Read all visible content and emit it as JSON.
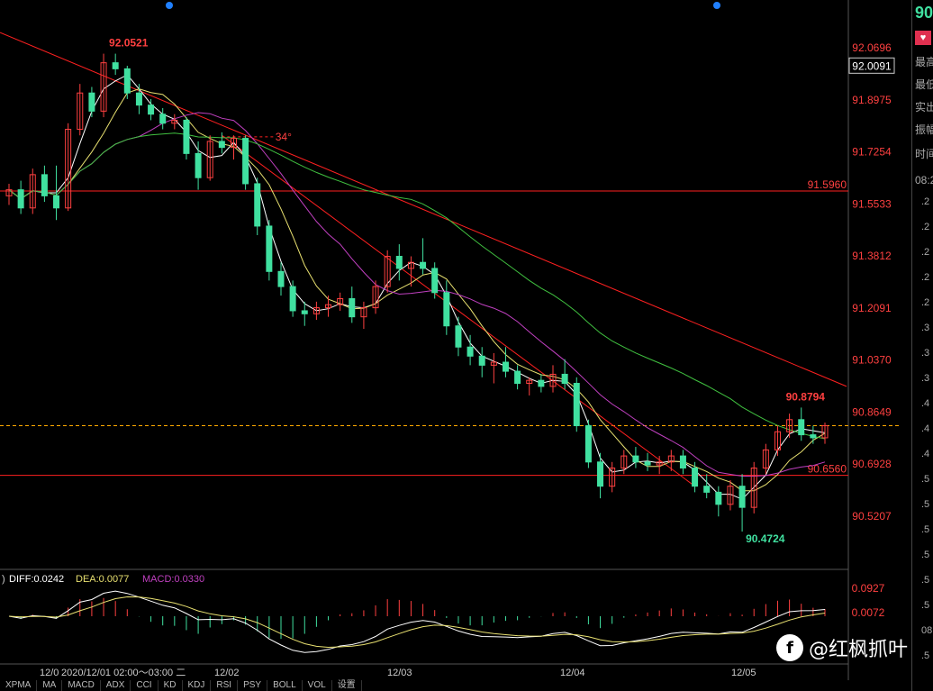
{
  "chart_data": {
    "type": "candlestick",
    "price_axis_labels": [
      "92.0696",
      "92.0091",
      "91.8975",
      "91.7254",
      "91.5533",
      "91.3812",
      "91.2091",
      "91.0370",
      "90.8649",
      "90.6928",
      "90.5207"
    ],
    "current_price_label": "92.0091",
    "horizontal_levels": [
      {
        "value": 91.596,
        "label": "91.5960"
      },
      {
        "value": 90.656,
        "label": "90.6560"
      }
    ],
    "annotations": [
      {
        "text": "92.0521",
        "kind": "high"
      },
      {
        "text": "90.8794",
        "kind": "high"
      },
      {
        "text": "90.4724",
        "kind": "low"
      },
      {
        "text": "34°",
        "kind": "angle"
      }
    ],
    "x_labels": [
      "12/0",
      "2020/12/01 02:00～03:00 二",
      "12/02",
      "12/03",
      "12/04",
      "12/05"
    ],
    "candles": [
      [
        91.58,
        91.62,
        91.55,
        91.6
      ],
      [
        91.6,
        91.63,
        91.52,
        91.54
      ],
      [
        91.54,
        91.67,
        91.52,
        91.65
      ],
      [
        91.65,
        91.68,
        91.56,
        91.58
      ],
      [
        91.58,
        91.68,
        91.5,
        91.54
      ],
      [
        91.54,
        91.82,
        91.53,
        91.8
      ],
      [
        91.8,
        91.95,
        91.78,
        91.92
      ],
      [
        91.92,
        91.94,
        91.84,
        91.86
      ],
      [
        91.86,
        92.05,
        91.84,
        92.02
      ],
      [
        92.02,
        92.05,
        91.98,
        92.0
      ],
      [
        92.0,
        92.01,
        91.9,
        91.92
      ],
      [
        91.92,
        91.95,
        91.85,
        91.88
      ],
      [
        91.88,
        91.9,
        91.83,
        91.85
      ],
      [
        91.85,
        91.87,
        91.8,
        91.82
      ],
      [
        91.82,
        91.85,
        91.8,
        91.83
      ],
      [
        91.83,
        91.84,
        91.7,
        91.72
      ],
      [
        91.72,
        91.76,
        91.6,
        91.64
      ],
      [
        91.64,
        91.78,
        91.63,
        91.76
      ],
      [
        91.76,
        91.79,
        91.72,
        91.74
      ],
      [
        91.74,
        91.78,
        91.7,
        91.77
      ],
      [
        91.77,
        91.78,
        91.6,
        91.62
      ],
      [
        91.62,
        91.64,
        91.45,
        91.48
      ],
      [
        91.48,
        91.5,
        91.3,
        91.33
      ],
      [
        91.33,
        91.36,
        91.25,
        91.28
      ],
      [
        91.28,
        91.3,
        91.18,
        91.2
      ],
      [
        91.2,
        91.23,
        91.15,
        91.19
      ],
      [
        91.19,
        91.23,
        91.17,
        91.21
      ],
      [
        91.21,
        91.25,
        91.18,
        91.22
      ],
      [
        91.22,
        91.26,
        91.2,
        91.24
      ],
      [
        91.24,
        91.28,
        91.16,
        91.18
      ],
      [
        91.18,
        91.23,
        91.14,
        91.21
      ],
      [
        91.21,
        91.3,
        91.19,
        91.28
      ],
      [
        91.28,
        91.4,
        91.26,
        91.38
      ],
      [
        91.38,
        91.42,
        91.3,
        91.34
      ],
      [
        91.34,
        91.38,
        91.28,
        91.36
      ],
      [
        91.36,
        91.44,
        91.32,
        91.34
      ],
      [
        91.34,
        91.36,
        91.24,
        91.26
      ],
      [
        91.26,
        91.3,
        91.12,
        91.15
      ],
      [
        91.15,
        91.18,
        91.05,
        91.08
      ],
      [
        91.08,
        91.12,
        91.02,
        91.05
      ],
      [
        91.05,
        91.08,
        90.98,
        91.02
      ],
      [
        91.02,
        91.06,
        90.96,
        91.03
      ],
      [
        91.03,
        91.08,
        90.98,
        91.0
      ],
      [
        91.0,
        91.02,
        90.94,
        90.96
      ],
      [
        90.96,
        90.98,
        90.92,
        90.97
      ],
      [
        90.97,
        90.99,
        90.93,
        90.95
      ],
      [
        90.95,
        91.02,
        90.93,
        90.99
      ],
      [
        90.99,
        91.04,
        90.94,
        90.96
      ],
      [
        90.96,
        90.98,
        90.8,
        90.82
      ],
      [
        90.82,
        90.84,
        90.68,
        90.7
      ],
      [
        90.7,
        90.73,
        90.58,
        90.62
      ],
      [
        90.62,
        90.7,
        90.6,
        90.68
      ],
      [
        90.68,
        90.74,
        90.66,
        90.72
      ],
      [
        90.72,
        90.75,
        90.68,
        90.7
      ],
      [
        90.7,
        90.73,
        90.67,
        90.69
      ],
      [
        90.69,
        90.72,
        90.66,
        90.7
      ],
      [
        90.7,
        90.74,
        90.67,
        90.72
      ],
      [
        90.72,
        90.74,
        90.66,
        90.68
      ],
      [
        90.68,
        90.7,
        90.6,
        90.62
      ],
      [
        90.62,
        90.66,
        90.58,
        90.6
      ],
      [
        90.6,
        90.62,
        90.52,
        90.56
      ],
      [
        90.56,
        90.64,
        90.54,
        90.62
      ],
      [
        90.62,
        90.66,
        90.47,
        90.55
      ],
      [
        90.55,
        90.7,
        90.53,
        90.68
      ],
      [
        90.68,
        90.76,
        90.66,
        90.74
      ],
      [
        90.74,
        90.82,
        90.72,
        90.8
      ],
      [
        90.8,
        90.86,
        90.78,
        90.84
      ],
      [
        90.84,
        90.88,
        90.77,
        90.79
      ],
      [
        90.79,
        90.82,
        90.76,
        90.78
      ],
      [
        90.78,
        90.83,
        90.76,
        90.82
      ]
    ],
    "ma_series_colors": [
      "#ffffff",
      "#e8e070",
      "#c040c0",
      "#40c040"
    ],
    "indicator": {
      "labels": [
        "DIFF:0.0242",
        "DEA:0.0077",
        "MACD:0.0330"
      ],
      "prefix": ")",
      "axis_labels": [
        "0.0927",
        "0.0072"
      ],
      "colors": {
        "diff": "#ffffff",
        "dea": "#e8e070",
        "macd": "#c040c0"
      }
    }
  },
  "tabs": [
    "XPMA",
    "MA",
    "MACD",
    "ADX",
    "CCI",
    "KD",
    "KDJ",
    "RSI",
    "PSY",
    "BOLL",
    "VOL",
    "设置"
  ],
  "side_panel": {
    "top": "90",
    "rows": [
      "最高",
      "最低",
      "实出",
      "振幅",
      "时间",
      "08:2"
    ],
    "right_ticks": [
      ".2",
      ".2",
      ".2",
      ".2",
      ".2",
      ".3",
      ".3",
      ".3",
      ".4",
      ".4",
      ".4",
      ".5",
      ".5",
      ".5",
      ".5",
      ".5",
      ".5",
      "08:2",
      ".5"
    ]
  },
  "watermark": {
    "text": "@红枫抓叶",
    "icon": "f"
  },
  "colors": {
    "up": "#ff4040",
    "down": "#40e0a0",
    "trend": "#ff2020",
    "level": "#ff2020",
    "dashed": "#ffaa00",
    "label": "#ff4040",
    "low_label": "#40e0a0"
  }
}
